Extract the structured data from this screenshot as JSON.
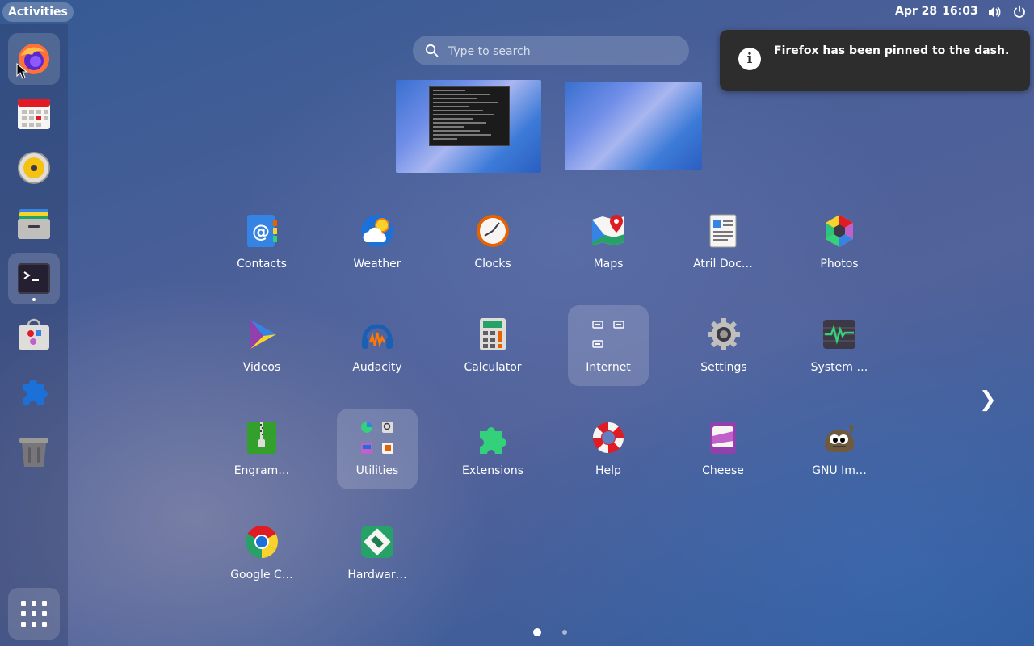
{
  "topbar": {
    "activities_label": "Activities",
    "date": "Apr 28",
    "time": "16:03",
    "tray_icons": [
      "volume-icon",
      "power-icon"
    ]
  },
  "dash": {
    "items": [
      {
        "name": "firefox",
        "icon": "firefox-icon"
      },
      {
        "name": "calendar",
        "icon": "calendar-icon"
      },
      {
        "name": "rhythmbox",
        "icon": "rhythmbox-icon"
      },
      {
        "name": "files",
        "icon": "files-icon"
      },
      {
        "name": "terminal",
        "icon": "terminal-icon",
        "running": true
      },
      {
        "name": "software",
        "icon": "software-icon"
      },
      {
        "name": "extensions",
        "icon": "extensions-icon"
      },
      {
        "name": "trash",
        "icon": "trash-icon"
      },
      {
        "name": "show-apps",
        "icon": "grid-icon"
      }
    ]
  },
  "search": {
    "placeholder": "Type to search",
    "value": ""
  },
  "notification": {
    "icon": "info-icon",
    "message": "Firefox has been pinned to the dash."
  },
  "workspaces": [
    "workspace-1",
    "workspace-2"
  ],
  "apps": [
    {
      "label": "Contacts",
      "icon": "contacts-icon"
    },
    {
      "label": "Weather",
      "icon": "weather-icon"
    },
    {
      "label": "Clocks",
      "icon": "clocks-icon"
    },
    {
      "label": "Maps",
      "icon": "maps-icon"
    },
    {
      "label": "Atril Doc…",
      "icon": "document-viewer-icon"
    },
    {
      "label": "Photos",
      "icon": "photos-icon"
    },
    {
      "label": "Videos",
      "icon": "videos-icon"
    },
    {
      "label": "Audacity",
      "icon": "audacity-icon"
    },
    {
      "label": "Calculator",
      "icon": "calculator-icon"
    },
    {
      "label": "Internet",
      "icon": "folder-icon",
      "folder": true
    },
    {
      "label": "Settings",
      "icon": "settings-icon"
    },
    {
      "label": "System …",
      "icon": "system-monitor-icon"
    },
    {
      "label": "Engram…",
      "icon": "archive-icon"
    },
    {
      "label": "Utilities",
      "icon": "folder-icon",
      "folder": true
    },
    {
      "label": "Extensions",
      "icon": "extensions-icon"
    },
    {
      "label": "Help",
      "icon": "help-icon"
    },
    {
      "label": "Cheese",
      "icon": "cheese-icon"
    },
    {
      "label": "GNU Im…",
      "icon": "gimp-icon"
    },
    {
      "label": "Google C…",
      "icon": "chrome-icon"
    },
    {
      "label": "Hardwar…",
      "icon": "hardware-icon"
    }
  ],
  "pagination": {
    "pages": 2,
    "current": 1
  },
  "colors": {
    "notification_bg": "#2e2d2d",
    "folder_bg": "rgba(255,255,255,0.16)"
  }
}
